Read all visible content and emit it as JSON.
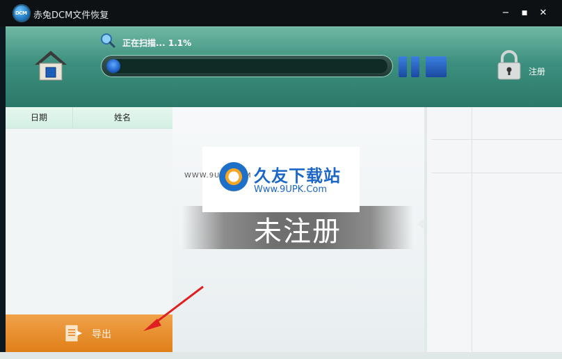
{
  "window": {
    "title": "赤兔DCM文件恢复",
    "logo_text": "DCM"
  },
  "controls": {
    "minimize": "−",
    "maximize": "■",
    "close": "✕"
  },
  "header": {
    "scan_status": "正在扫描... 1.1%",
    "progress_value": 0.011,
    "register_label": "注册"
  },
  "table": {
    "columns": [
      "日期",
      "姓名"
    ]
  },
  "actions": {
    "export_label": "导出"
  },
  "main": {
    "unregistered_banner": "未注册"
  },
  "watermark": {
    "title": "久友下载站",
    "url": "Www.9UPK.Com",
    "side_text": "WWW.9UPK.COM"
  },
  "colors": {
    "header_teal": "#3c8f7e",
    "accent_blue": "#1f5fc7",
    "export_orange": "#e07f18"
  },
  "icons": [
    "app-logo-icon",
    "home-icon",
    "magnifier-icon",
    "pause-icon",
    "stop-icon",
    "lock-icon",
    "export-icon"
  ]
}
